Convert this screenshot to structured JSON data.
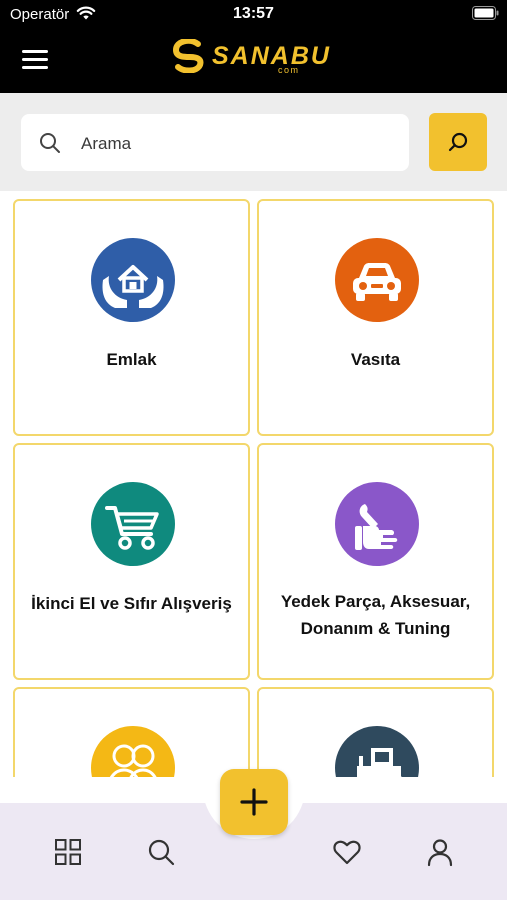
{
  "status_bar": {
    "carrier": "Operatör",
    "time": "13:57"
  },
  "header": {
    "logo_text": "SANABU",
    "logo_sub": "com"
  },
  "search": {
    "placeholder": "Arama",
    "value": ""
  },
  "categories": [
    {
      "label": "Emlak",
      "icon": "house-hands-icon",
      "color": "#2f5ea8"
    },
    {
      "label": "Vasıta",
      "icon": "car-icon",
      "color": "#e3610f"
    },
    {
      "label": "İkinci El ve Sıfır Alışveriş",
      "icon": "shopping-cart-icon",
      "color": "#0f8a7e"
    },
    {
      "label": "Yedek Parça, Aksesuar, Donanım & Tuning",
      "label_line1": "Yedek Parça, Aksesuar,",
      "label_line2": "Donanım & Tuning",
      "icon": "wrench-hand-icon",
      "color": "#8a57c9"
    },
    {
      "label": "",
      "icon": "people-icon",
      "color": "#f4b815"
    },
    {
      "label": "",
      "icon": "tractor-icon",
      "color": "#2f4a5e"
    }
  ],
  "bottom_nav": {
    "items": [
      {
        "name": "grid-icon"
      },
      {
        "name": "search-icon"
      },
      {
        "name": "heart-icon"
      },
      {
        "name": "user-icon"
      }
    ],
    "fab_icon": "plus-icon"
  },
  "colors": {
    "accent": "#f2c12e",
    "card_border": "#f3d76b",
    "nav_bg": "#ede8f3",
    "header_bg": "#000000"
  }
}
